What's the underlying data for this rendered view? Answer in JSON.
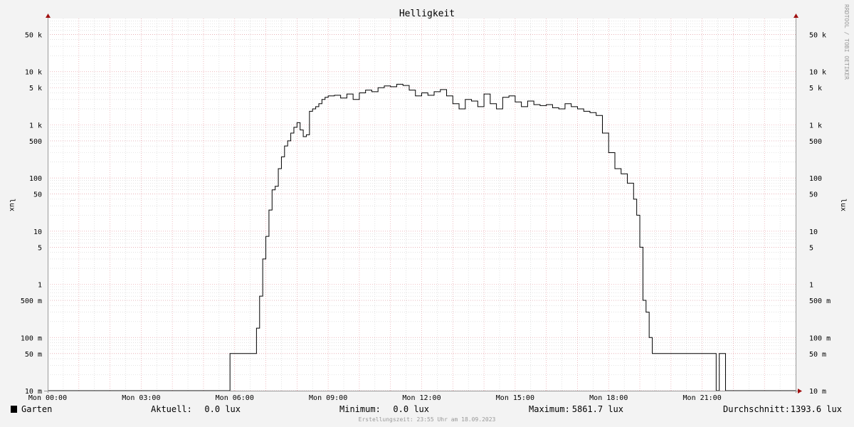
{
  "chart_data": {
    "type": "line",
    "title": "Helligkeit",
    "ylabel": "lux",
    "y_scale": "log",
    "ylim": [
      0.01,
      100000
    ],
    "xlim": [
      "Mon 00:00",
      "Mon 24:00"
    ],
    "x_ticks": [
      "Mon 00:00",
      "Mon 03:00",
      "Mon 06:00",
      "Mon 09:00",
      "Mon 12:00",
      "Mon 15:00",
      "Mon 18:00",
      "Mon 21:00"
    ],
    "y_ticks": [
      {
        "value": 50000,
        "label": "50 k"
      },
      {
        "value": 10000,
        "label": "10 k"
      },
      {
        "value": 5000,
        "label": "5 k"
      },
      {
        "value": 1000,
        "label": "1 k"
      },
      {
        "value": 500,
        "label": "500"
      },
      {
        "value": 100,
        "label": "100"
      },
      {
        "value": 50,
        "label": "50"
      },
      {
        "value": 10,
        "label": "10"
      },
      {
        "value": 5,
        "label": "5"
      },
      {
        "value": 1,
        "label": "1"
      },
      {
        "value": 0.5,
        "label": "500 m"
      },
      {
        "value": 0.1,
        "label": "100 m"
      },
      {
        "value": 0.05,
        "label": "50 m"
      },
      {
        "value": 0.01,
        "label": "10 m"
      }
    ],
    "grid": true,
    "series": [
      {
        "name": "Garten",
        "color": "#000000",
        "x_hours": [
          0,
          5.85,
          5.85,
          6.6,
          6.7,
          6.8,
          6.9,
          7.0,
          7.1,
          7.2,
          7.3,
          7.4,
          7.5,
          7.6,
          7.7,
          7.8,
          7.9,
          8.0,
          8.1,
          8.2,
          8.3,
          8.4,
          8.5,
          8.6,
          8.7,
          8.8,
          8.9,
          9.0,
          9.2,
          9.4,
          9.6,
          9.8,
          10.0,
          10.2,
          10.4,
          10.6,
          10.8,
          11.0,
          11.2,
          11.4,
          11.6,
          11.8,
          12.0,
          12.2,
          12.4,
          12.6,
          12.8,
          13.0,
          13.2,
          13.4,
          13.6,
          13.8,
          14.0,
          14.2,
          14.4,
          14.6,
          14.8,
          15.0,
          15.2,
          15.4,
          15.6,
          15.8,
          16.0,
          16.2,
          16.4,
          16.6,
          16.8,
          17.0,
          17.2,
          17.4,
          17.6,
          17.8,
          18.0,
          18.2,
          18.4,
          18.6,
          18.8,
          18.9,
          19.0,
          19.1,
          19.2,
          19.3,
          19.4,
          19.5,
          19.6,
          19.7,
          19.8,
          19.9,
          20.0,
          20.1,
          20.2,
          21.0,
          21.4,
          21.45,
          21.55,
          21.6,
          21.7,
          21.75,
          24.0
        ],
        "values": [
          0.01,
          0.01,
          0.05,
          0.05,
          0.15,
          0.6,
          3,
          8,
          25,
          60,
          70,
          150,
          250,
          400,
          500,
          700,
          900,
          1100,
          800,
          600,
          650,
          1800,
          2000,
          2200,
          2500,
          3000,
          3300,
          3500,
          3600,
          3200,
          3800,
          3000,
          4000,
          4500,
          4200,
          5000,
          5400,
          5200,
          5800,
          5500,
          4500,
          3500,
          4000,
          3600,
          4200,
          4600,
          3500,
          2500,
          2000,
          3000,
          2800,
          2200,
          3800,
          2500,
          2000,
          3300,
          3500,
          2700,
          2200,
          2800,
          2400,
          2300,
          2400,
          2100,
          2000,
          2500,
          2200,
          2000,
          1800,
          1700,
          1500,
          700,
          300,
          150,
          120,
          80,
          40,
          20,
          5,
          0.5,
          0.3,
          0.1,
          0.05,
          0.05,
          0.05,
          0.05,
          0.05,
          0.05,
          0.05,
          0.05,
          0.05,
          0.05,
          0.05,
          0.01,
          0.05,
          0.05,
          0.05,
          0.01,
          0.01
        ]
      }
    ]
  },
  "legend": {
    "series_name": "Garten",
    "aktuell_label": "Aktuell:",
    "aktuell_value": "0.0 lux",
    "minimum_label": "Minimum:",
    "minimum_value": "0.0 lux",
    "maximum_label": "Maximum:",
    "maximum_value": "5861.7 lux",
    "durchschnitt_label": "Durchschnitt:",
    "durchschnitt_value": "1393.6 lux"
  },
  "footer": "Erstellungszeit: 23:55 Uhr am 18.09.2023",
  "watermark": "RRDTOOL / TOBI OETIKER",
  "colors": {
    "background": "#f3f3f3",
    "canvas": "#ffffff",
    "major_grid": "#e8a0a8",
    "minor_grid": "#cccccc",
    "axis": "#999999",
    "arrow": "#a01010"
  }
}
